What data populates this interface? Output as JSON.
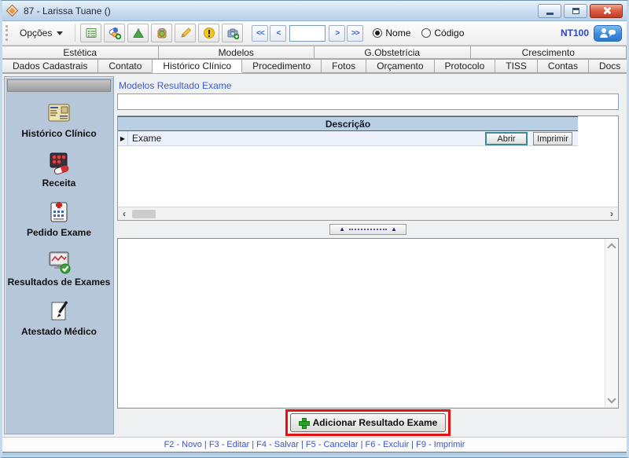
{
  "window": {
    "title": "87 - Larissa Tuane ()"
  },
  "toolbar": {
    "options_label": "Opções",
    "icons": [
      "record-form-icon",
      "prescription-pills-icon",
      "exam-flask-icon",
      "procedure-jar-icon",
      "edit-pencil-icon",
      "alert-icon",
      "photo-camera-add-icon"
    ],
    "nav": {
      "first": "<<",
      "prev": "<",
      "value": "",
      "next": ">",
      "last": ">>"
    },
    "search_mode": {
      "nome": "Nome",
      "codigo": "Código",
      "selected": "Nome"
    },
    "user_code": "NT100"
  },
  "tabs_top": [
    "Estética",
    "Modelos",
    "G.Obstetrícia",
    "Crescimento"
  ],
  "tabs_main": [
    "Dados Cadastrais",
    "Contato",
    "Histórico Clínico",
    "Procedimento",
    "Fotos",
    "Orçamento",
    "Protocolo",
    "TISS",
    "Contas",
    "Docs"
  ],
  "active_tab": "Histórico Clínico",
  "sidebar": {
    "items": [
      {
        "label": "Histórico Clínico",
        "icon": "medical-record-icon"
      },
      {
        "label": "Receita",
        "icon": "pills-blister-icon"
      },
      {
        "label": "Pedido Exame",
        "icon": "exam-request-icon"
      },
      {
        "label": "Resultados de Exames",
        "icon": "exam-results-icon"
      },
      {
        "label": "Atestado Médico",
        "icon": "certificate-icon"
      }
    ]
  },
  "main": {
    "section_label": "Modelos Resultado Exame",
    "filter_value": "",
    "table": {
      "header": "Descrição",
      "rows": [
        {
          "description": "Exame",
          "open_label": "Abrir",
          "print_label": "Imprimir"
        }
      ]
    },
    "editor_value": "",
    "add_button_label": "Adicionar Resultado Exame"
  },
  "statusbar": {
    "text": "F2 - Novo | F3 - Editar | F4 - Salvar | F5 - Cancelar | F6 - Excluir | F9 - Imprimir"
  },
  "colors": {
    "accent_blue": "#3b5bd6",
    "highlight_red": "#e01212",
    "sidebar_bg": "#b6c7da",
    "table_header_bg": "#b9cfe4"
  }
}
